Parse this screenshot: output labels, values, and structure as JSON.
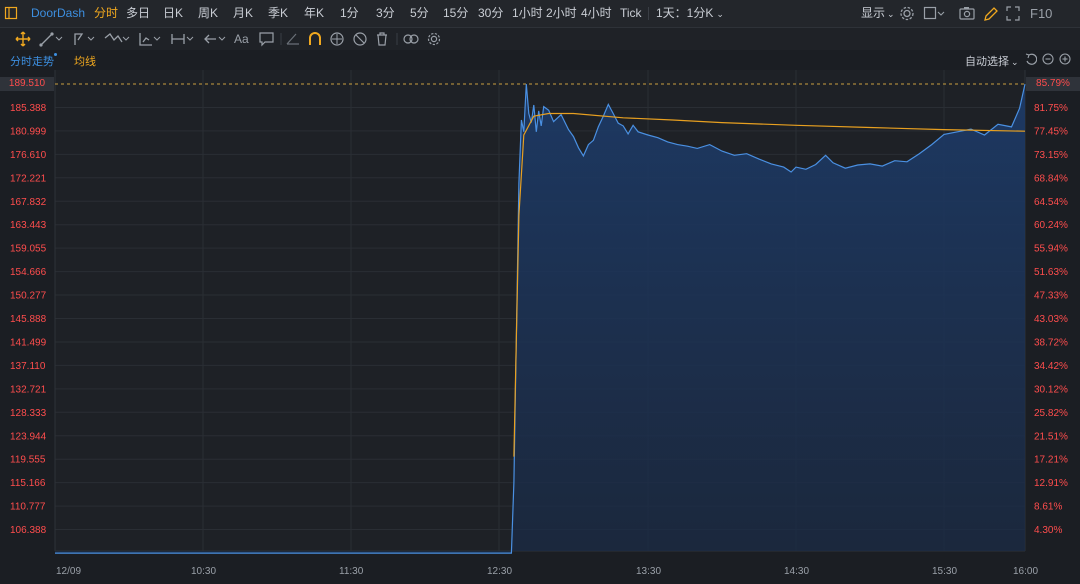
{
  "toolbar": {
    "brand": "DoorDash",
    "periods": [
      "分时",
      "多日",
      "日K",
      "周K",
      "月K",
      "季K",
      "年K",
      "1分",
      "3分",
      "5分",
      "15分",
      "30分",
      "1小时",
      "2小时",
      "4小时",
      "Tick"
    ],
    "active_period": "分时",
    "custom_period": "1天：1分K",
    "display_label": "显示",
    "right_label": "F10"
  },
  "subbar": {
    "tab_timeline": "分时走势",
    "tab_avg": "均线",
    "auto_select": "自动选择"
  },
  "colors": {
    "price_line": "#4a90e2",
    "avg_line": "#e8a020",
    "axis_text_red": "#ff4d4d",
    "grid": "#2a2e34"
  },
  "chart_data": {
    "type": "area",
    "y_ticks": [
      "189.510",
      "185.388",
      "180.999",
      "176.610",
      "172.221",
      "167.832",
      "163.443",
      "159.055",
      "154.666",
      "150.277",
      "145.888",
      "141.499",
      "137.110",
      "132.721",
      "128.333",
      "123.944",
      "119.555",
      "115.166",
      "110.777",
      "106.388"
    ],
    "pct_ticks": [
      "85.79%",
      "81.75%",
      "77.45%",
      "73.15%",
      "68.84%",
      "64.54%",
      "60.24%",
      "55.94%",
      "51.63%",
      "47.33%",
      "43.03%",
      "38.72%",
      "34.42%",
      "30.12%",
      "25.82%",
      "21.51%",
      "17.21%",
      "12.91%",
      "8.61%",
      "4.30%"
    ],
    "x_ticks": [
      "12/09",
      "10:30",
      "11:30",
      "12:30",
      "13:30",
      "14:30",
      "15:30",
      "16:00"
    ],
    "ylim": [
      102.0,
      189.51
    ],
    "last_price": "189.510",
    "last_pct": "85.79%",
    "series": [
      {
        "name": "分时",
        "points": [
          [
            "09:30",
            102.0
          ],
          [
            "12:35",
            102.0
          ],
          [
            "12:36",
            115.2
          ],
          [
            "12:37",
            143.0
          ],
          [
            "12:38",
            171.0
          ],
          [
            "12:39",
            182.8
          ],
          [
            "12:40",
            180.6
          ],
          [
            "12:41",
            189.5
          ],
          [
            "12:42",
            184.0
          ],
          [
            "12:43",
            182.3
          ],
          [
            "12:44",
            185.6
          ],
          [
            "12:45",
            180.6
          ],
          [
            "12:46",
            184.5
          ],
          [
            "12:47",
            181.7
          ],
          [
            "12:48",
            185.3
          ],
          [
            "12:50",
            184.6
          ],
          [
            "12:52",
            182.5
          ],
          [
            "12:55",
            183.8
          ],
          [
            "12:58",
            181.0
          ],
          [
            "13:00",
            179.7
          ],
          [
            "13:02",
            177.6
          ],
          [
            "13:04",
            176.1
          ],
          [
            "13:06",
            178.2
          ],
          [
            "13:08",
            179.0
          ],
          [
            "13:10",
            181.5
          ],
          [
            "13:12",
            183.5
          ],
          [
            "13:14",
            185.7
          ],
          [
            "13:16",
            184.0
          ],
          [
            "13:18",
            182.2
          ],
          [
            "13:20",
            181.7
          ],
          [
            "13:22",
            180.2
          ],
          [
            "13:24",
            181.8
          ],
          [
            "13:26",
            180.6
          ],
          [
            "13:30",
            180.0
          ],
          [
            "13:34",
            179.5
          ],
          [
            "13:38",
            178.7
          ],
          [
            "13:42",
            178.2
          ],
          [
            "13:46",
            177.9
          ],
          [
            "13:50",
            177.5
          ],
          [
            "13:55",
            178.2
          ],
          [
            "14:00",
            177.0
          ],
          [
            "14:05",
            176.2
          ],
          [
            "14:10",
            176.5
          ],
          [
            "14:15",
            175.5
          ],
          [
            "14:20",
            174.6
          ],
          [
            "14:25",
            174.0
          ],
          [
            "14:28",
            173.1
          ],
          [
            "14:30",
            174.0
          ],
          [
            "14:34",
            173.6
          ],
          [
            "14:38",
            174.5
          ],
          [
            "14:42",
            176.2
          ],
          [
            "14:45",
            174.8
          ],
          [
            "14:50",
            173.8
          ],
          [
            "14:55",
            174.4
          ],
          [
            "15:00",
            174.6
          ],
          [
            "15:05",
            174.2
          ],
          [
            "15:10",
            175.2
          ],
          [
            "15:15",
            175.0
          ],
          [
            "15:20",
            176.5
          ],
          [
            "15:25",
            178.2
          ],
          [
            "15:30",
            180.1
          ],
          [
            "15:35",
            180.6
          ],
          [
            "15:40",
            181.1
          ],
          [
            "15:45",
            180.0
          ],
          [
            "15:50",
            182.0
          ],
          [
            "15:55",
            181.5
          ],
          [
            "15:58",
            185.0
          ],
          [
            "16:00",
            189.5
          ]
        ]
      },
      {
        "name": "均线",
        "points": [
          [
            "12:36",
            120.0
          ],
          [
            "12:38",
            165.0
          ],
          [
            "12:40",
            180.0
          ],
          [
            "12:44",
            183.5
          ],
          [
            "12:50",
            184.0
          ],
          [
            "13:00",
            184.0
          ],
          [
            "13:20",
            183.2
          ],
          [
            "13:40",
            182.8
          ],
          [
            "14:00",
            182.3
          ],
          [
            "14:30",
            181.8
          ],
          [
            "15:00",
            181.4
          ],
          [
            "15:30",
            181.0
          ],
          [
            "16:00",
            180.7
          ]
        ]
      }
    ]
  }
}
